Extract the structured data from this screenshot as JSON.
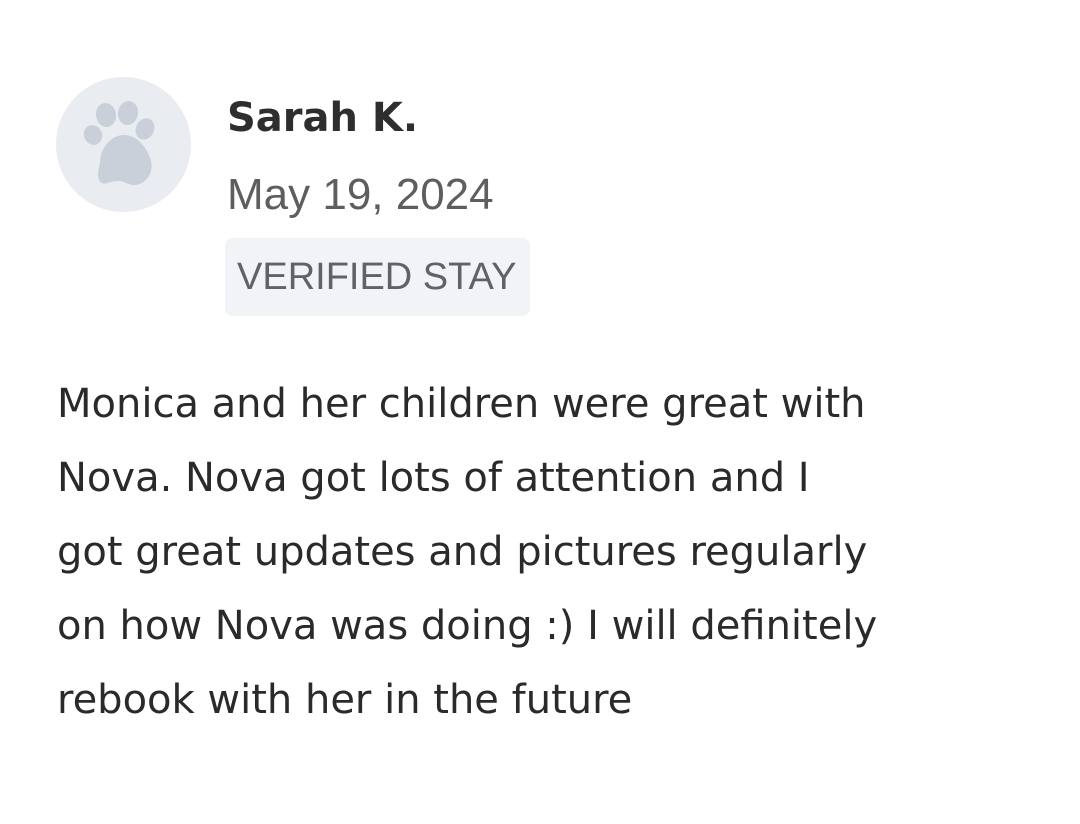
{
  "review": {
    "reviewer_name": "Sarah K.",
    "date": "May 19, 2024",
    "badge": "VERIFIED STAY",
    "avatar_icon": "paw-icon",
    "text_lines": [
      "Monica and her children were great with",
      "Nova. Nova got lots of attention and I",
      "got great updates and pictures regularly",
      "on how Nova was doing :) I will definitely",
      "rebook with her in the future"
    ]
  },
  "colors": {
    "avatar_bg": "#e9ecf0",
    "paw": "#c9d0d9",
    "badge_bg": "#f1f3f6",
    "text": "#2a2a2a"
  }
}
